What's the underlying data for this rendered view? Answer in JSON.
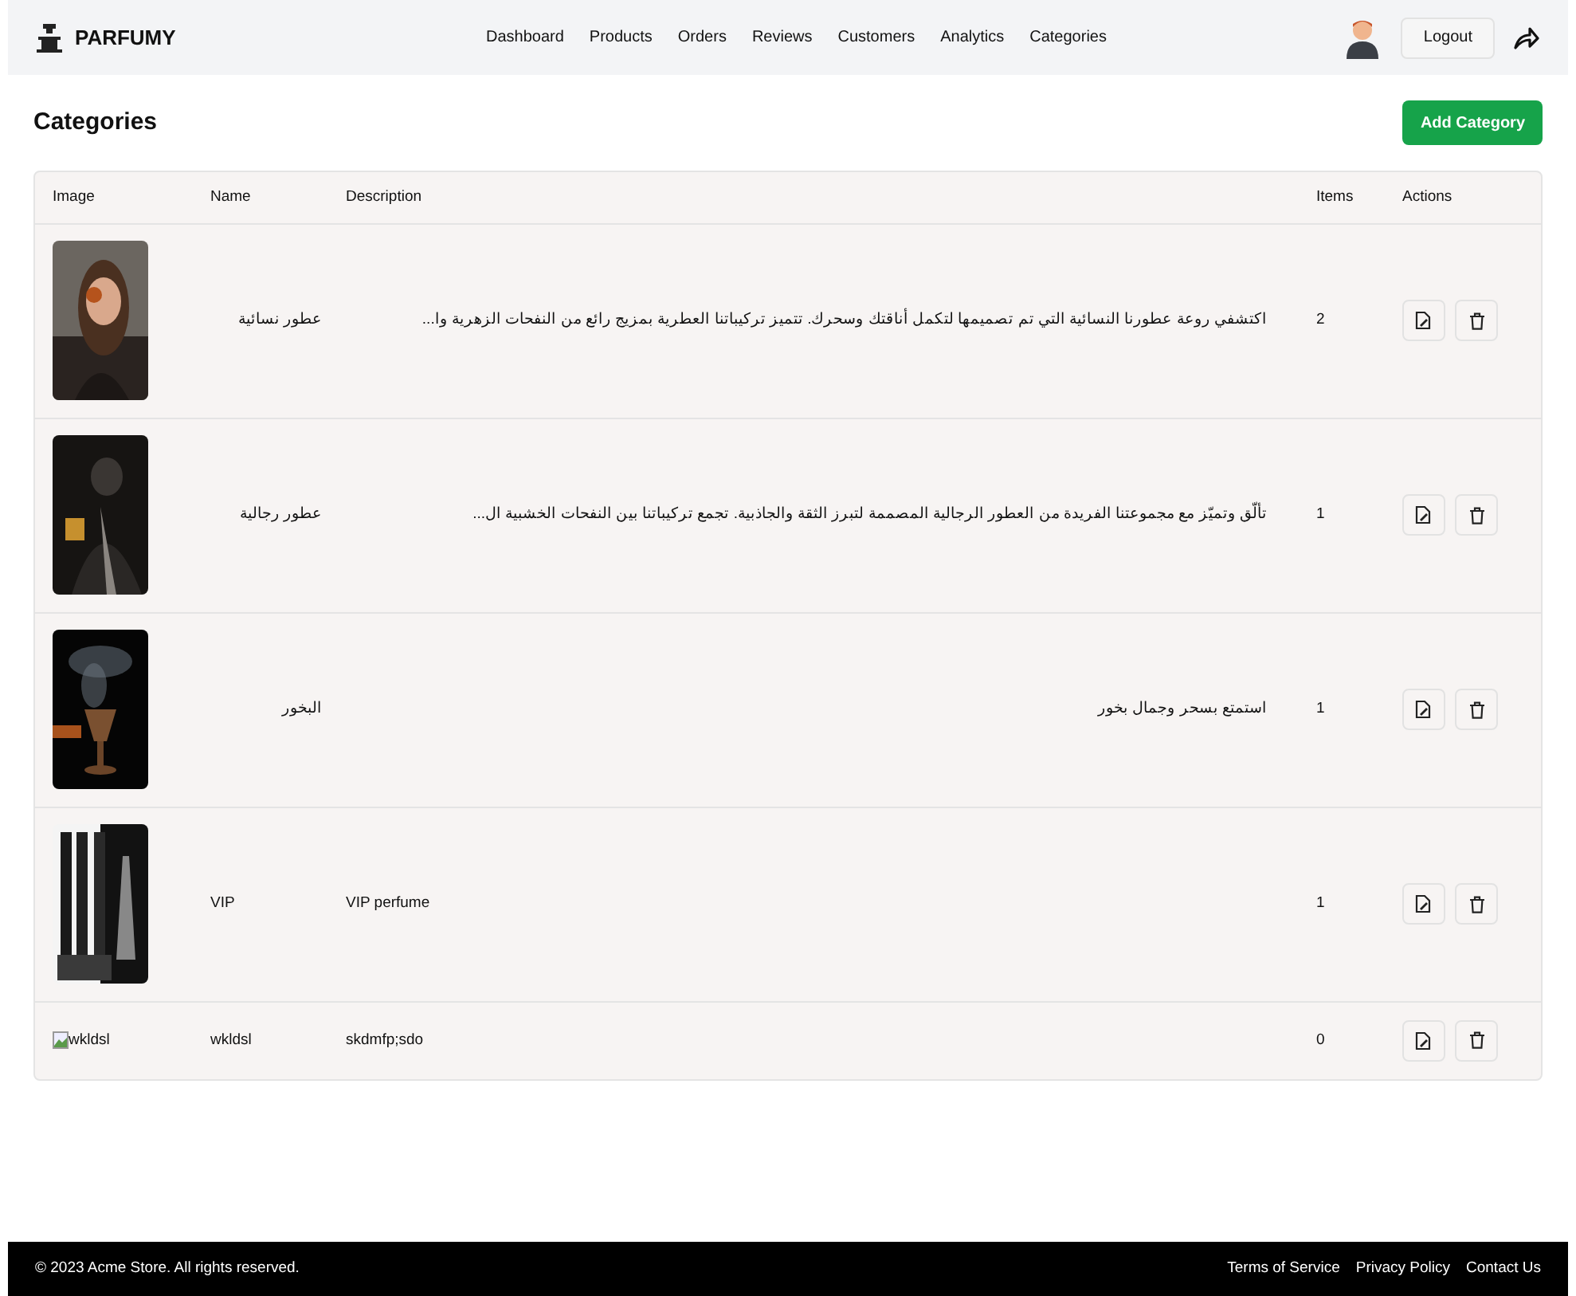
{
  "header": {
    "brand": "PARFUMY",
    "nav": [
      "Dashboard",
      "Products",
      "Orders",
      "Reviews",
      "Customers",
      "Analytics",
      "Categories"
    ],
    "logout": "Logout"
  },
  "page": {
    "title": "Categories",
    "add_button": "Add Category"
  },
  "table": {
    "columns": [
      "Image",
      "Name",
      "Description",
      "Items",
      "Actions"
    ],
    "rows": [
      {
        "name": "عطور نسائية",
        "description": "اكتشفي روعة عطورنا النسائية التي تم تصميمها لتكمل أناقتك وسحرك. تتميز تركيباتنا العطرية بمزيج رائع من النفحات الزهرية وا...",
        "items": "2"
      },
      {
        "name": "عطور رجالية",
        "description": "تألّق وتميّز مع مجموعتنا الفريدة من العطور الرجالية المصممة لتبرز الثقة والجاذبية. تجمع تركيباتنا بين النفحات الخشبية ال...",
        "items": "1"
      },
      {
        "name": "البخور",
        "description": "استمتع بسحر وجمال بخور",
        "items": "1"
      },
      {
        "name": "VIP",
        "description": "VIP perfume",
        "items": "1"
      },
      {
        "image": {
          "kind": "broken",
          "alt": "wkldsl"
        },
        "name": "wkldsl",
        "description": "skdmfp;sdo",
        "items": "0"
      }
    ]
  },
  "footer": {
    "copyright": "© 2023 Acme Store. All rights reserved.",
    "links": [
      "Terms of Service",
      "Privacy Policy",
      "Contact Us"
    ]
  }
}
